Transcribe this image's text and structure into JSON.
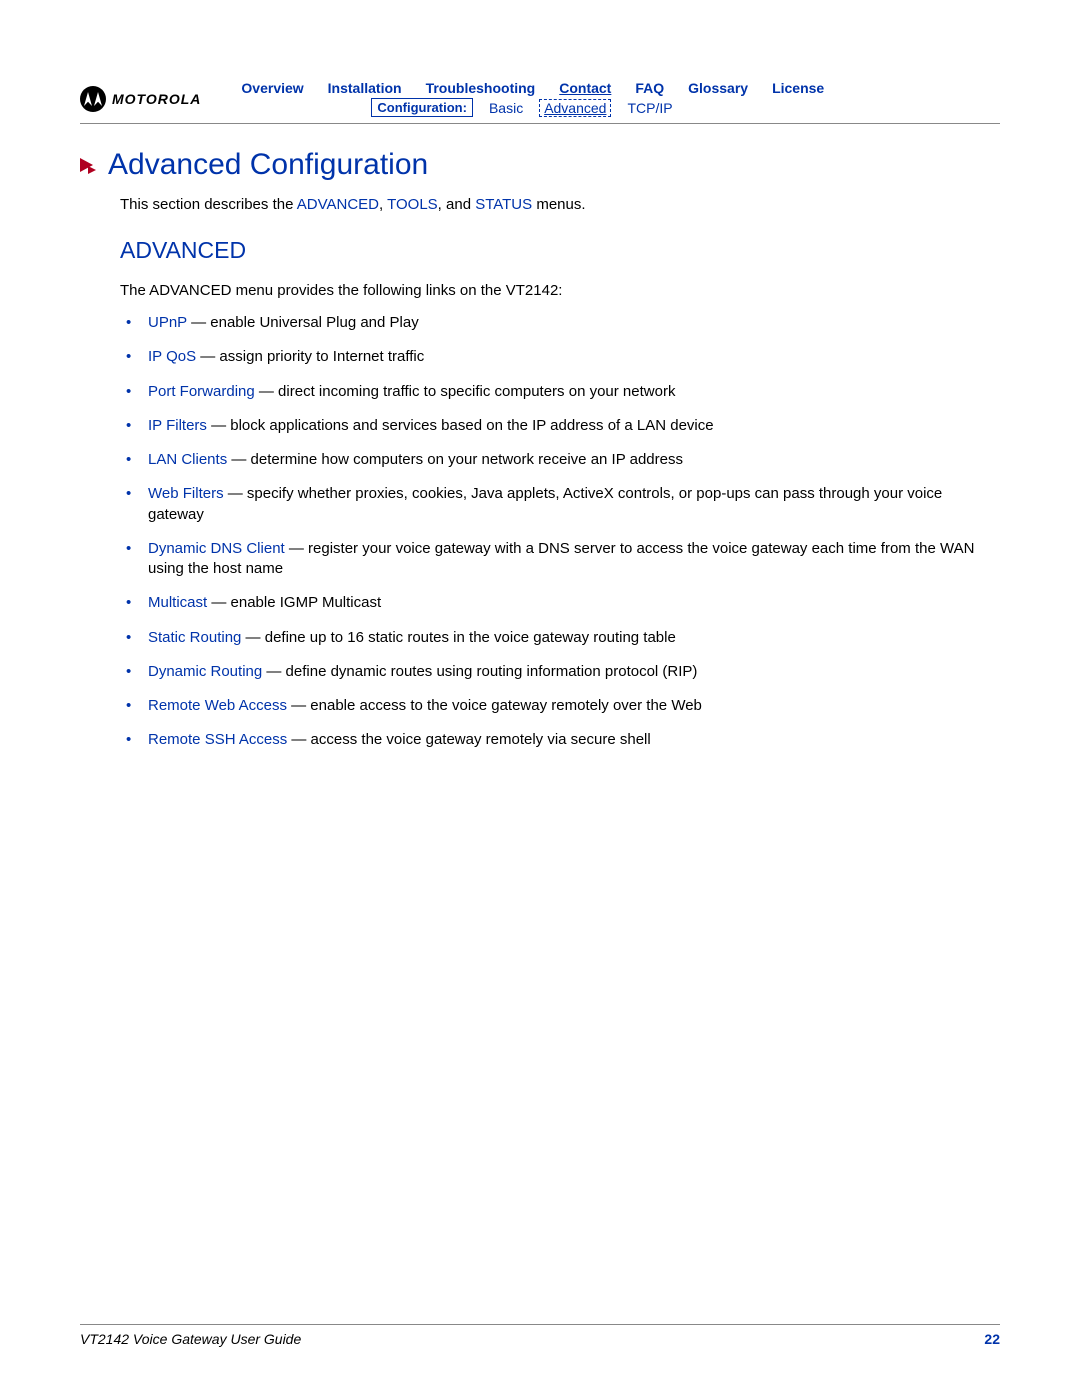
{
  "brand": "MOTOROLA",
  "nav": {
    "row1": [
      "Overview",
      "Installation",
      "Troubleshooting",
      "Contact",
      "FAQ",
      "Glossary",
      "License"
    ],
    "row2_label": "Configuration:",
    "row2": [
      "Basic",
      "Advanced",
      "TCP/IP"
    ],
    "row2_selected_index": 1,
    "underline_indices": [
      3
    ]
  },
  "title": "Advanced Configuration",
  "intro": {
    "prefix": "This section describes the ",
    "links": [
      "ADVANCED",
      "TOOLS",
      "STATUS"
    ],
    "sep1": ", ",
    "sep2": ", and ",
    "suffix": " menus."
  },
  "section_heading": "ADVANCED",
  "section_lead": "The ADVANCED menu provides the following links on the VT2142:",
  "features": [
    {
      "term": "UPnP",
      "desc": " — enable Universal Plug and Play"
    },
    {
      "term": "IP QoS",
      "desc": " — assign priority to Internet traffic"
    },
    {
      "term": "Port Forwarding",
      "desc": " — direct incoming traffic to specific computers on your network"
    },
    {
      "term": "IP Filters",
      "desc": " — block applications and services based on the IP address of a LAN device"
    },
    {
      "term": "LAN Clients",
      "desc": " — determine how computers on your network receive an IP address"
    },
    {
      "term": "Web Filters",
      "desc": " — specify whether proxies, cookies, Java applets, ActiveX controls, or pop-ups can pass through your voice gateway"
    },
    {
      "term": "Dynamic DNS Client",
      "desc": " — register your voice gateway with a DNS server to access the voice gateway each time from the WAN using the host name"
    },
    {
      "term": "Multicast",
      "desc": " — enable IGMP Multicast"
    },
    {
      "term": "Static Routing",
      "desc": " — define up to 16 static routes in the voice gateway routing table"
    },
    {
      "term": "Dynamic Routing",
      "desc": " — define dynamic routes using routing information protocol (RIP)"
    },
    {
      "term": "Remote Web Access",
      "desc": " — enable access to the voice gateway remotely over the Web"
    },
    {
      "term": "Remote SSH Access",
      "desc": " — access the voice gateway remotely via secure shell"
    }
  ],
  "footer": {
    "guide": "VT2142 Voice Gateway User Guide",
    "page": "22"
  }
}
